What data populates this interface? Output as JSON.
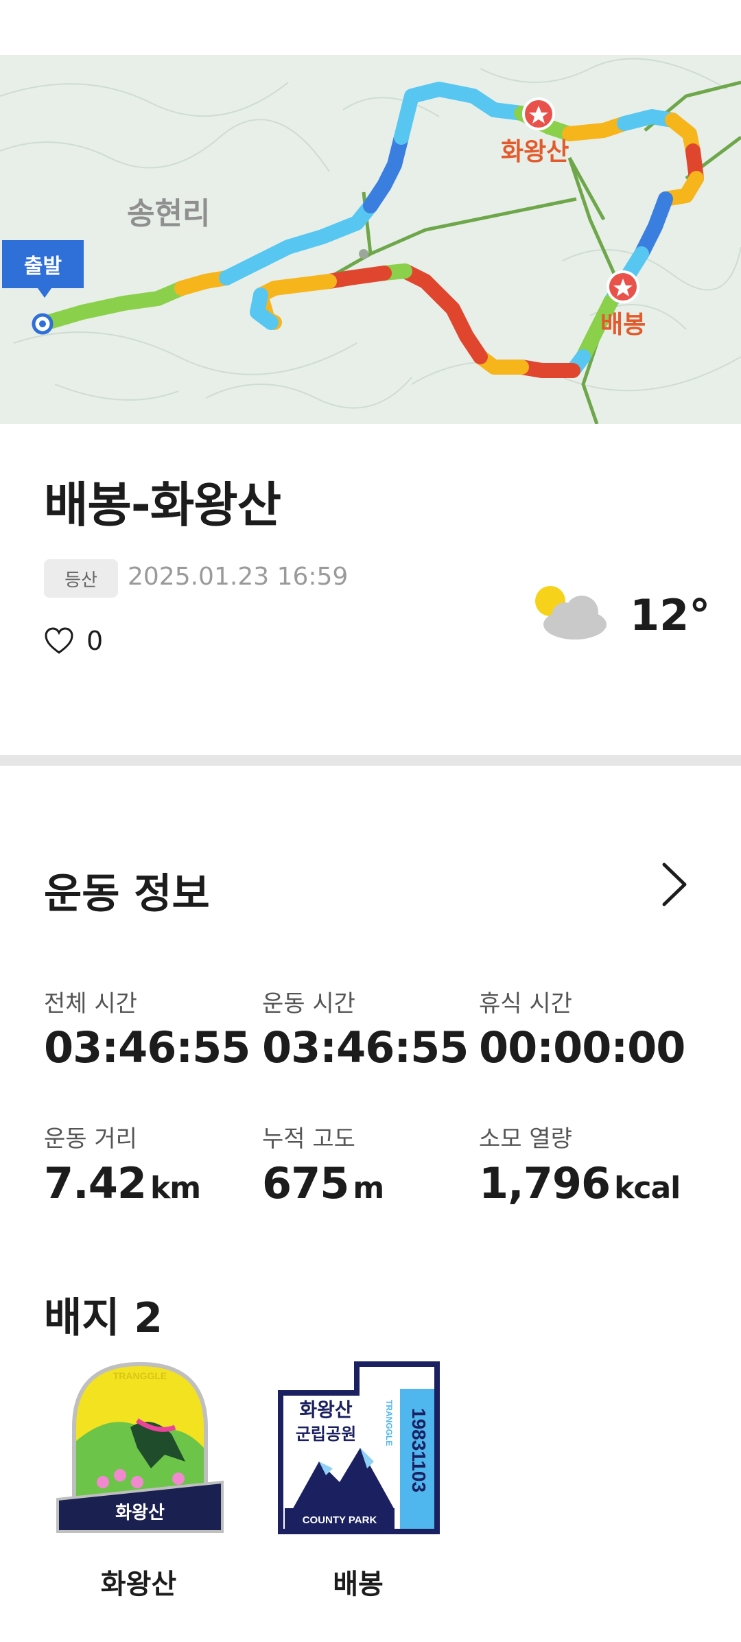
{
  "map": {
    "start_label": "출발",
    "place_label": "송현리",
    "peak1_label": "화왕산",
    "peak2_label": "배봉"
  },
  "activity": {
    "title": "배봉-화왕산",
    "tag": "등산",
    "datetime": "2025.01.23 16:59",
    "likes": "0",
    "temperature": "12°",
    "weather_icon": "partly-cloudy-icon"
  },
  "stats": {
    "section_title": "운동 정보",
    "items": [
      {
        "label": "전체 시간",
        "value": "03:46:55",
        "unit": ""
      },
      {
        "label": "운동 시간",
        "value": "03:46:55",
        "unit": ""
      },
      {
        "label": "휴식 시간",
        "value": "00:00:00",
        "unit": ""
      },
      {
        "label": "운동 거리",
        "value": "7.42",
        "unit": "km"
      },
      {
        "label": "누적 고도",
        "value": "675",
        "unit": "m"
      },
      {
        "label": "소모 열량",
        "value": "1,796",
        "unit": "kcal"
      }
    ]
  },
  "badges": {
    "section_title": "배지 2",
    "items": [
      {
        "name": "화왕산",
        "emblem_text": "화왕산",
        "arc_text": "TRANGGLE"
      },
      {
        "name": "배봉",
        "emblem_title": "화왕산",
        "emblem_subtitle": "군립공원",
        "code": "19831103",
        "vertical_text": "TRANGGLE",
        "footer": "COUNTY PARK"
      }
    ]
  }
}
